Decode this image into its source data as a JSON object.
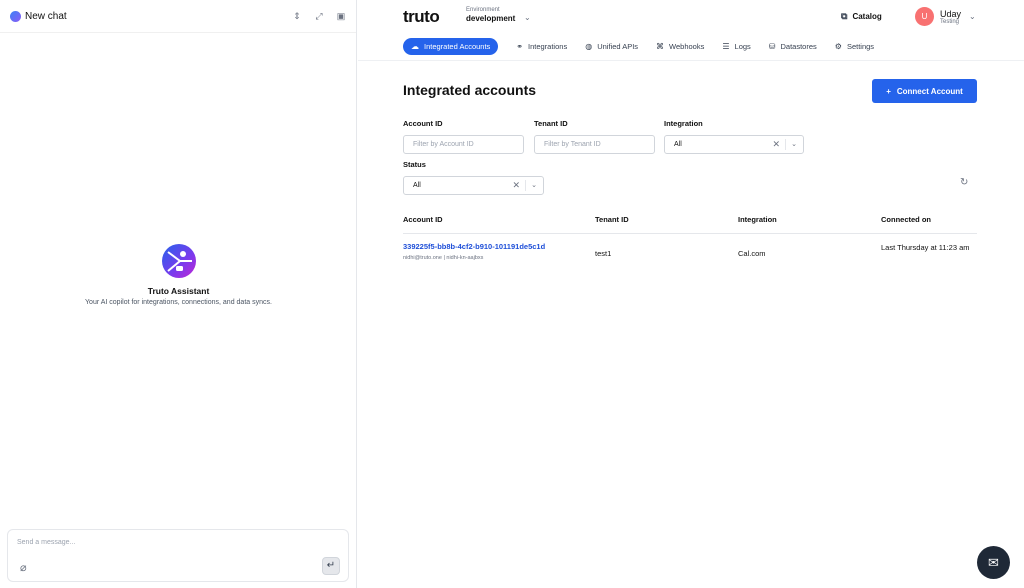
{
  "chat": {
    "header_title": "New chat",
    "assistant_name": "Truto Assistant",
    "assistant_tagline": "Your AI copilot for integrations, connections, and data syncs.",
    "composer_placeholder": "Send a message..."
  },
  "topbar": {
    "brand": "truto",
    "env_label": "Environment",
    "env_value": "development",
    "catalog": "Catalog",
    "user_initial": "U",
    "user_name": "Uday",
    "user_role": "Testing"
  },
  "tabs": [
    {
      "label": "Integrated Accounts",
      "icon": "cloud-icon",
      "active": true
    },
    {
      "label": "Integrations",
      "icon": "plug-icon"
    },
    {
      "label": "Unified APIs",
      "icon": "globe-icon"
    },
    {
      "label": "Webhooks",
      "icon": "webhook-icon"
    },
    {
      "label": "Logs",
      "icon": "list-icon"
    },
    {
      "label": "Datastores",
      "icon": "database-icon"
    },
    {
      "label": "Settings",
      "icon": "gear-icon"
    }
  ],
  "page": {
    "title": "Integrated accounts",
    "connect_label": "Connect Account"
  },
  "filters": {
    "account_id_label": "Account ID",
    "account_id_placeholder": "Filter by Account ID",
    "tenant_id_label": "Tenant ID",
    "tenant_id_placeholder": "Filter by Tenant ID",
    "integration_label": "Integration",
    "integration_value": "All",
    "status_label": "Status",
    "status_value": "All"
  },
  "table": {
    "headers": [
      "Account ID",
      "Tenant ID",
      "Integration",
      "Connected on"
    ],
    "rows": [
      {
        "account_id": "339225f5-bb8b-4cf2-b910-101191de5c1d",
        "account_sub": "nidhi@truto.one | nidhi-kn-aajbxs",
        "tenant_id": "test1",
        "integration": "Cal.com",
        "connected_on": "Last Thursday at 11:23 am"
      }
    ]
  }
}
